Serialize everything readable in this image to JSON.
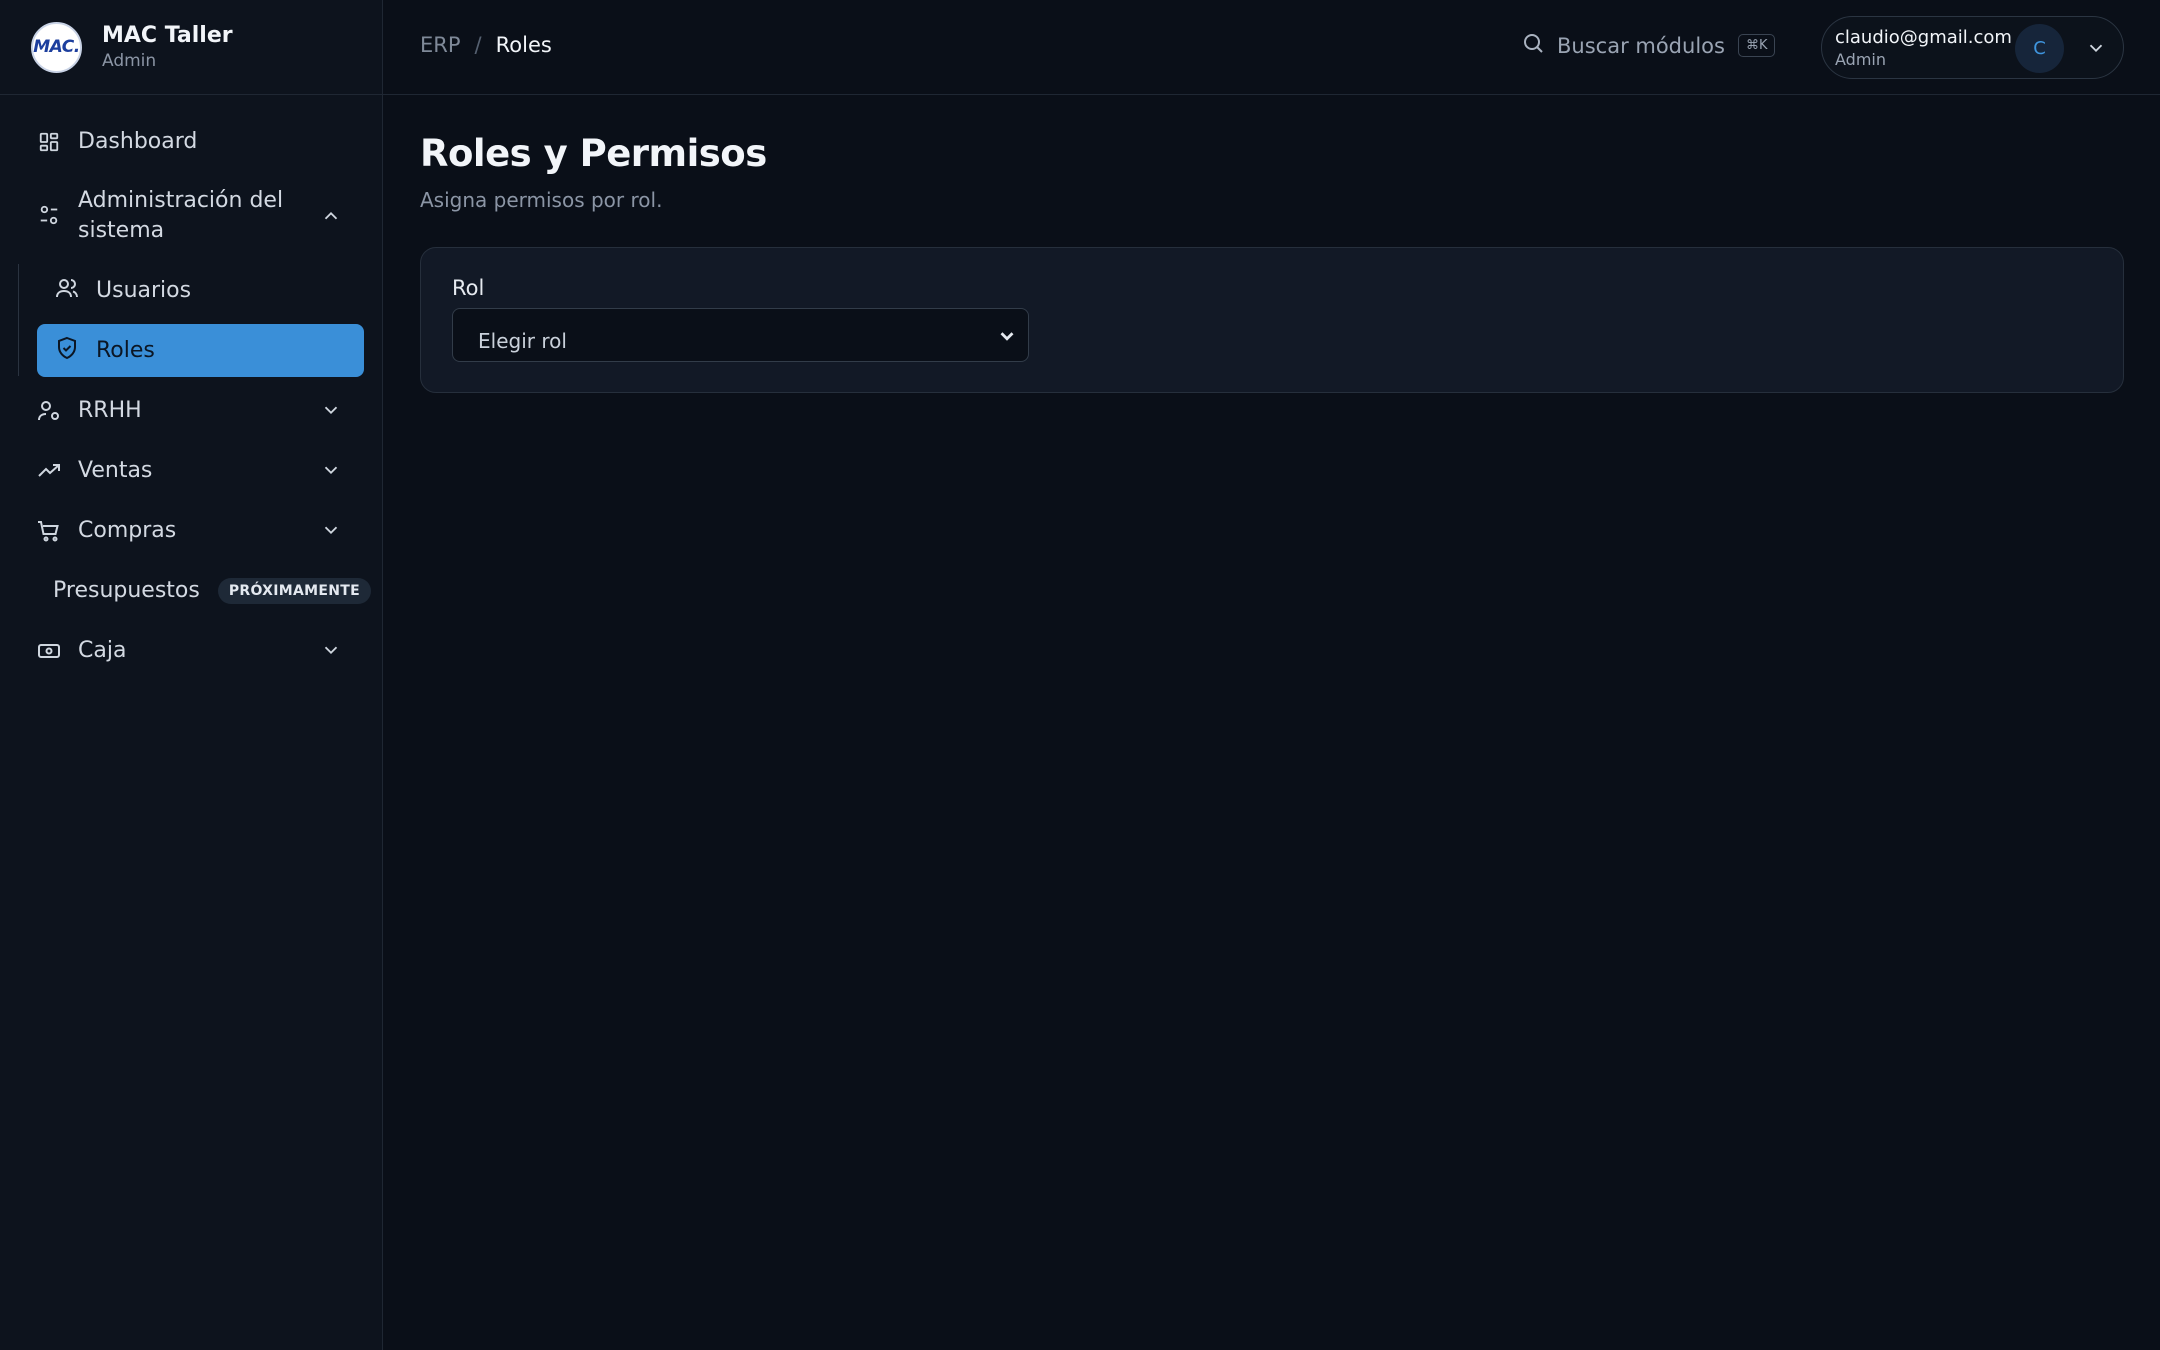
{
  "brand": {
    "logo_text": "MAC.",
    "name": "MAC Taller",
    "role": "Admin"
  },
  "sidebar": {
    "items": [
      {
        "label": "Dashboard"
      },
      {
        "label": "Administración del sistema"
      },
      {
        "label": "RRHH"
      },
      {
        "label": "Ventas"
      },
      {
        "label": "Compras"
      },
      {
        "label": "Presupuestos",
        "badge": "PRÓXIMAMENTE"
      },
      {
        "label": "Caja"
      }
    ],
    "sub_items": [
      {
        "label": "Usuarios"
      },
      {
        "label": "Roles"
      }
    ]
  },
  "breadcrumb": {
    "root": "ERP",
    "separator": "/",
    "current": "Roles"
  },
  "search": {
    "label": "Buscar módulos",
    "shortcut": "⌘K"
  },
  "user": {
    "email": "claudio@gmail.com",
    "role": "Admin",
    "initial": "C"
  },
  "main": {
    "title": "Roles y Permisos",
    "subtitle": "Asigna permisos por rol.",
    "role_field": {
      "label": "Rol",
      "selected": "Elegir rol"
    }
  },
  "colors": {
    "accent": "#3a8fd8",
    "background": "#0a0f18",
    "sidebar": "#0d131d"
  }
}
